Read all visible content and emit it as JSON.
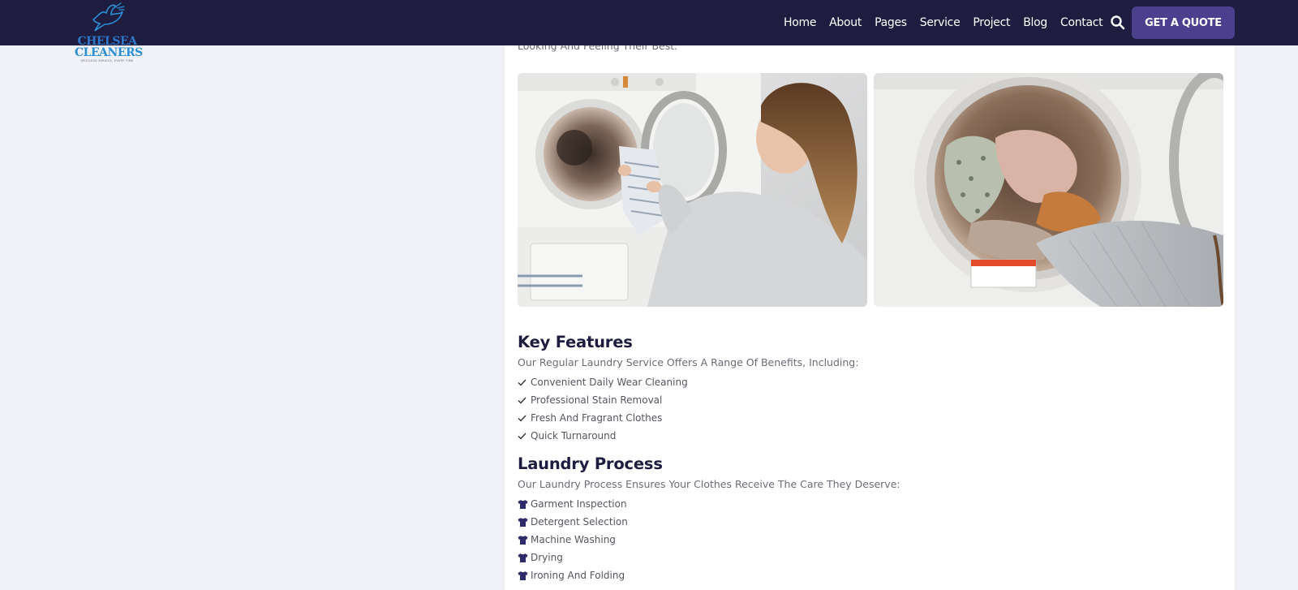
{
  "brand": {
    "name_line1": "CHELSEA",
    "name_line2": "CLEANERS",
    "tagline": "SPOTLESS SERVICE, EVERY TIME"
  },
  "nav": {
    "items": [
      "Home",
      "About",
      "Pages",
      "Service",
      "Project",
      "Blog",
      "Contact"
    ],
    "search_icon": "search-icon",
    "cta_label": "GET A QUOTE"
  },
  "colors": {
    "header_bg": "#1e1d3f",
    "accent": "#4b3f8e",
    "page_bg": "#f1f2f8",
    "heading": "#1e1d3f"
  },
  "content": {
    "intro_tail": "Looking And Feeling Their Best.",
    "images": [
      {
        "icon": "laundry-photo-woman-loading-dryer"
      },
      {
        "icon": "laundry-photo-clothes-in-drum"
      }
    ],
    "key_features": {
      "title": "Key Features",
      "subtitle": "Our Regular Laundry Service Offers A Range Of Benefits, Including:",
      "icon": "check-icon",
      "items": [
        "Convenient Daily Wear Cleaning",
        "Professional Stain Removal",
        "Fresh And Fragrant Clothes",
        "Quick Turnaround"
      ]
    },
    "laundry_process": {
      "title": "Laundry Process",
      "subtitle": "Our Laundry Process Ensures Your Clothes Receive The Care They Deserve:",
      "icon": "shirt-icon",
      "items": [
        "Garment Inspection",
        "Detergent Selection",
        "Machine Washing",
        "Drying",
        "Ironing And Folding"
      ]
    }
  }
}
